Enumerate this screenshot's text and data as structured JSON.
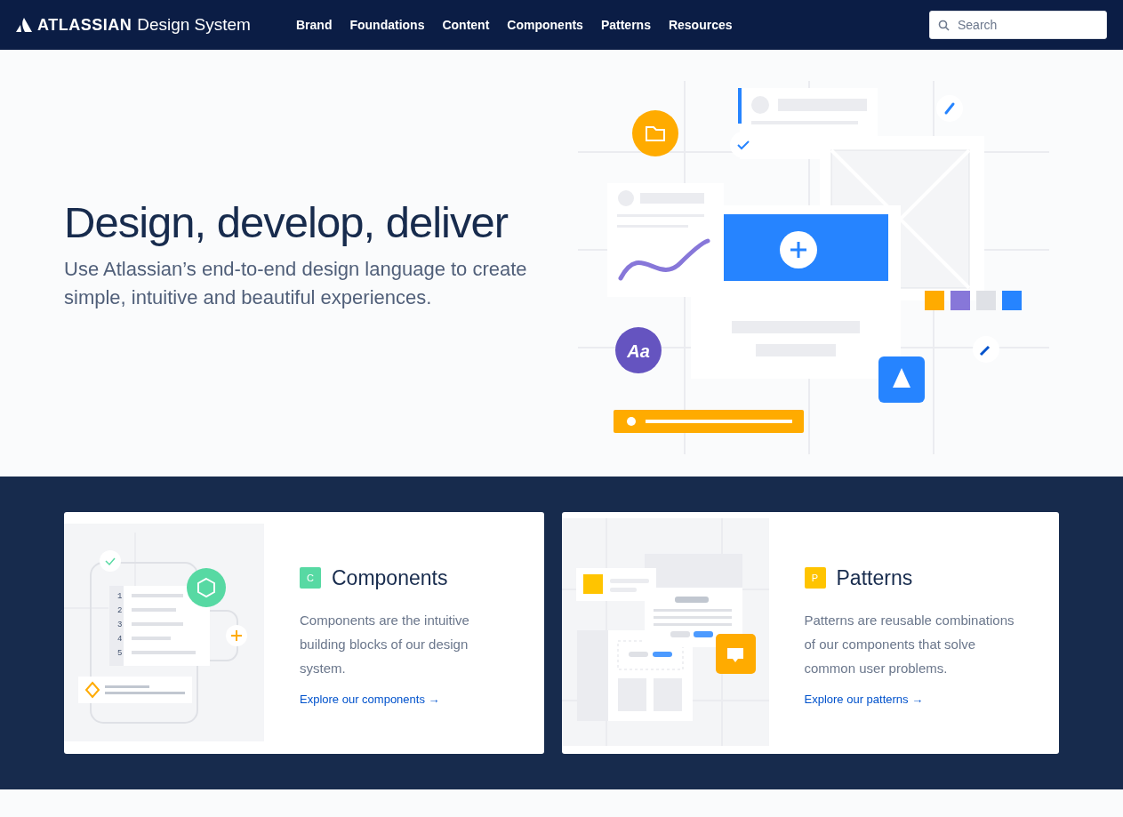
{
  "nav": {
    "logo_word": "ATLASSIAN",
    "logo_suffix": "Design System",
    "links": [
      {
        "label": "Brand"
      },
      {
        "label": "Foundations"
      },
      {
        "label": "Content"
      },
      {
        "label": "Components"
      },
      {
        "label": "Patterns"
      },
      {
        "label": "Resources"
      }
    ],
    "search": {
      "placeholder": "Search"
    }
  },
  "hero": {
    "title": "Design, develop, deliver",
    "subtitle": "Use Atlassian’s end-to-end design language to create simple, intuitive and beautiful experiences.",
    "art_type_label": "Aa"
  },
  "cards": [
    {
      "kind": "components",
      "badge": "C",
      "color": "#57d9a3",
      "title": "Components",
      "description": "Components are the intuitive building blocks of our design system.",
      "link": "Explore our components →",
      "art_line_numbers": [
        "1",
        "2",
        "3",
        "4",
        "5"
      ]
    },
    {
      "kind": "patterns",
      "badge": "P",
      "color": "#ffc400",
      "title": "Patterns",
      "description": "Patterns are reusable combinations of our components that solve common user problems.",
      "link": "Explore our patterns →"
    }
  ]
}
